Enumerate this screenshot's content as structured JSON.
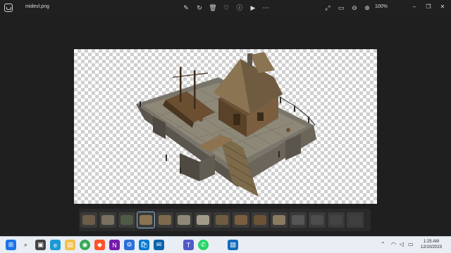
{
  "window": {
    "filename": "midevl.png",
    "zoom": "100%"
  },
  "toolbar": {
    "icons": [
      "edit-icon",
      "rotate-icon",
      "delete-icon",
      "favorite-icon",
      "info-icon",
      "slideshow-icon",
      "more-icon"
    ],
    "right_icons": [
      "fullscreen-icon",
      "fit-icon",
      "zoom-out-icon",
      "zoom-in-icon"
    ]
  },
  "window_controls": [
    "minimize-icon",
    "maximize-icon",
    "close-icon"
  ],
  "filmstrip": {
    "thumbnail_count": 15,
    "selected_index": 3
  },
  "taskbar": {
    "apps": [
      "start-icon",
      "search-icon",
      "task-view-icon",
      "edge-icon",
      "file-explorer-icon",
      "chrome-icon",
      "brave-icon",
      "onenote-icon",
      "settings-icon",
      "store-icon",
      "mail-icon",
      "teams-icon",
      "whatsapp-icon",
      "photos-icon"
    ],
    "time": "1:25 AM",
    "date": "12/10/2023"
  }
}
